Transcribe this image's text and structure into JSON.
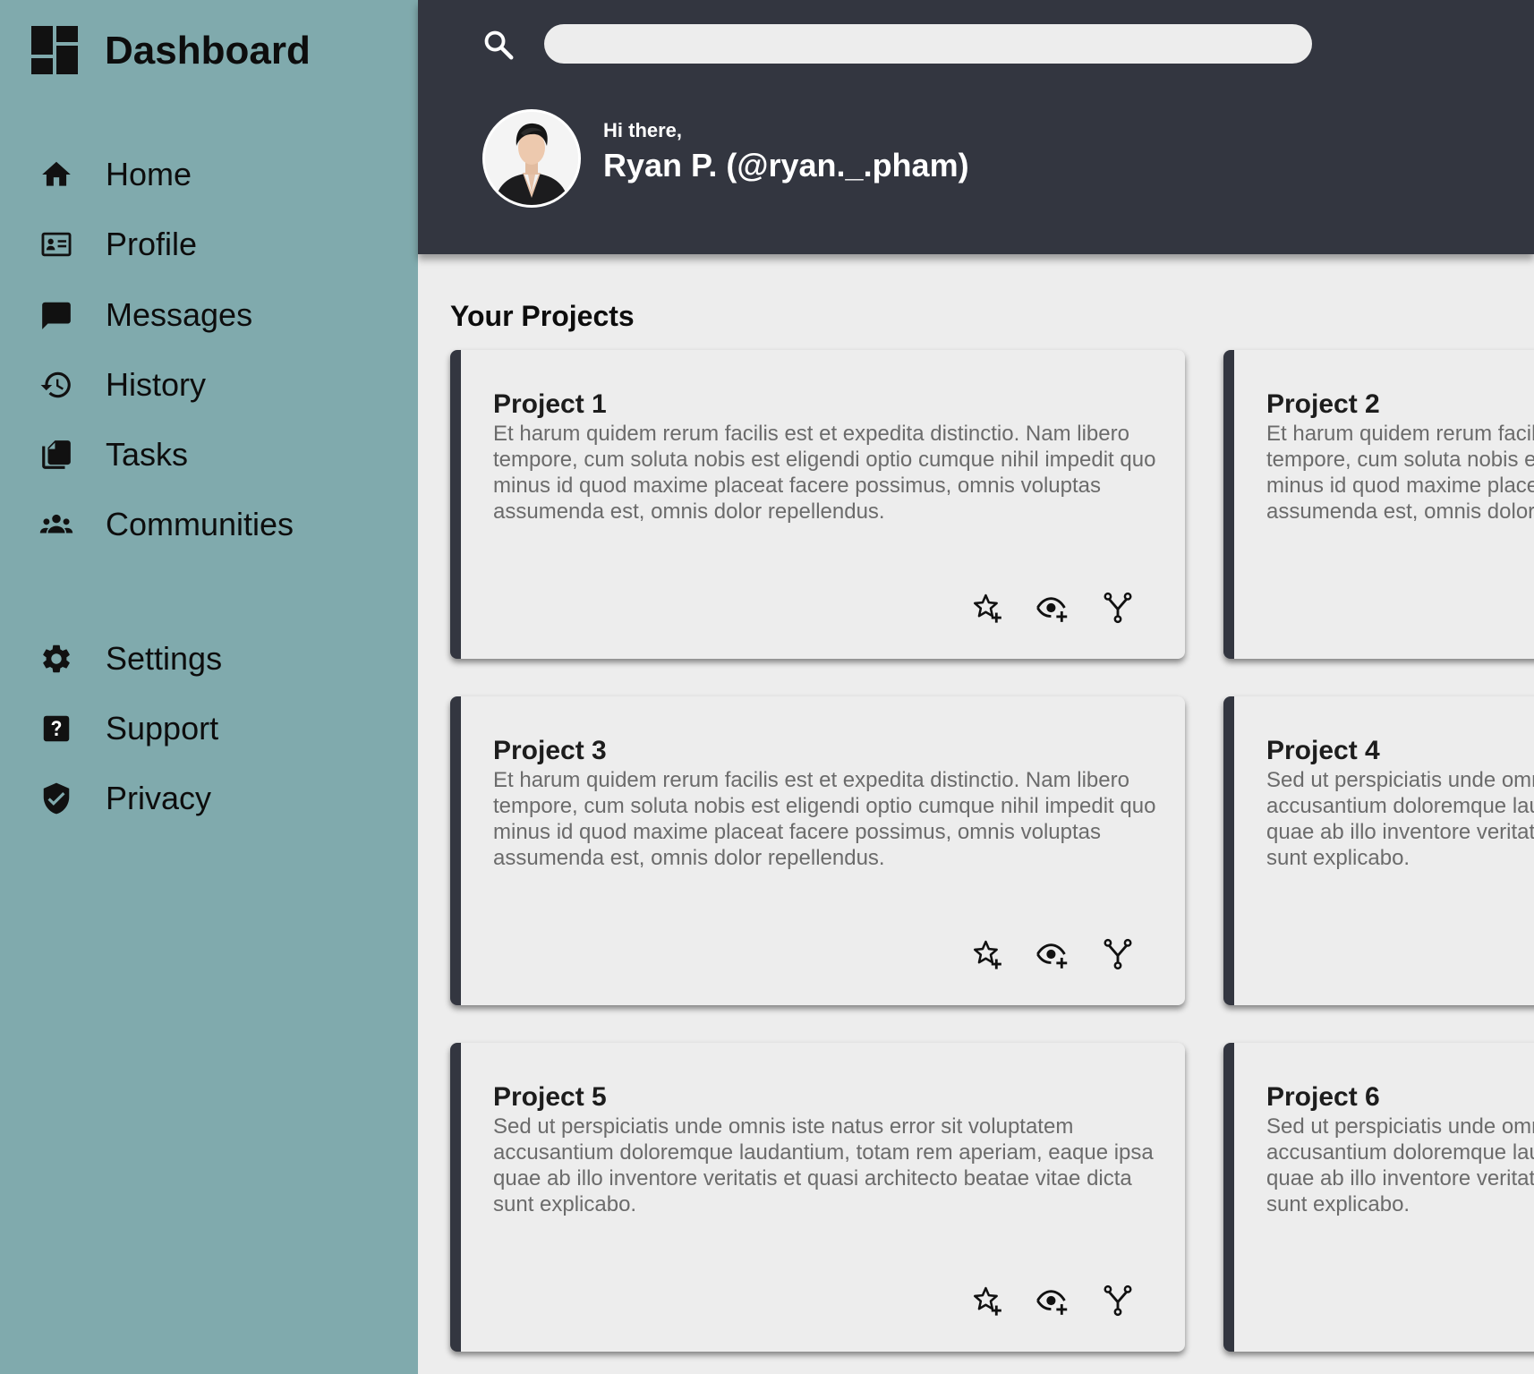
{
  "sidebar": {
    "brand": {
      "title": "Dashboard",
      "icon": "dashboard-icon"
    },
    "nav": [
      {
        "label": "Home",
        "icon": "home-icon"
      },
      {
        "label": "Profile",
        "icon": "id-card-icon"
      },
      {
        "label": "Messages",
        "icon": "message-icon"
      },
      {
        "label": "History",
        "icon": "history-icon"
      },
      {
        "label": "Tasks",
        "icon": "tasks-icon"
      },
      {
        "label": "Communities",
        "icon": "communities-icon"
      }
    ],
    "nav_secondary": [
      {
        "label": "Settings",
        "icon": "gear-icon"
      },
      {
        "label": "Support",
        "icon": "help-icon"
      },
      {
        "label": "Privacy",
        "icon": "shield-icon"
      }
    ]
  },
  "header": {
    "search": {
      "placeholder": "",
      "value": "",
      "icon": "search-icon"
    },
    "greeting": "Hi there,",
    "user_name": "Ryan P. (@ryan._.pham)",
    "avatar": "avatar"
  },
  "main": {
    "section_title": "Your Projects",
    "projects": [
      {
        "title": "Project 1",
        "description": "Et harum quidem rerum facilis est et expedita distinctio. Nam libero tempore, cum soluta nobis est eligendi optio cumque nihil impedit quo minus id quod maxime placeat facere possimus, omnis voluptas assumenda est, omnis dolor repellendus."
      },
      {
        "title": "Project 2",
        "description": "Et harum quidem rerum facilis est et expedita distinctio. Nam libero tempore, cum soluta nobis est eligendi optio cumque nihil impedit quo minus id quod maxime placeat facere possimus, omnis voluptas assumenda est, omnis dolor repellendus."
      },
      {
        "title": "Project 3",
        "description": "Et harum quidem rerum facilis est et expedita distinctio. Nam libero tempore, cum soluta nobis est eligendi optio cumque nihil impedit quo minus id quod maxime placeat facere possimus, omnis voluptas assumenda est, omnis dolor repellendus."
      },
      {
        "title": "Project 4",
        "description": "Sed ut perspiciatis unde omnis iste natus error sit voluptatem accusantium doloremque laudantium, totam rem aperiam, eaque ipsa quae ab illo inventore veritatis et quasi architecto beatae vitae dicta sunt explicabo."
      },
      {
        "title": "Project 5",
        "description": "Sed ut perspiciatis unde omnis iste natus error sit voluptatem accusantium doloremque laudantium, totam rem aperiam, eaque ipsa quae ab illo inventore veritatis et quasi architecto beatae vitae dicta sunt explicabo."
      },
      {
        "title": "Project 6",
        "description": "Sed ut perspiciatis unde omnis iste natus error sit voluptatem accusantium doloremque laudantium, totam rem aperiam, eaque ipsa quae ab illo inventore veritatis et quasi architecto beatae vitae dicta sunt explicabo."
      }
    ],
    "card_actions": [
      "star-add-icon",
      "watch-icon",
      "fork-icon"
    ]
  },
  "colors": {
    "sidebar_bg": "#80aaad",
    "header_bg": "#333640",
    "main_bg": "#ededed",
    "card_accent": "#333640"
  }
}
